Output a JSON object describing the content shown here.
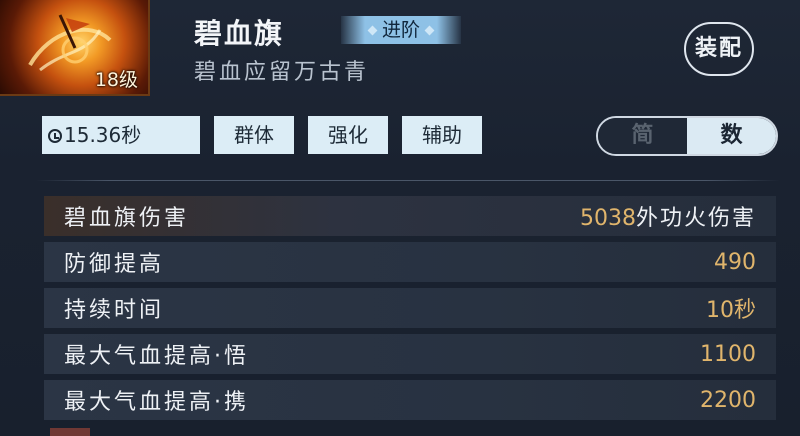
{
  "skill": {
    "level": "18级",
    "name": "碧血旗",
    "advance_tag": "进阶",
    "subtitle": "碧血应留万古青",
    "equip_label": "装配",
    "icon": "flame-swirl-icon"
  },
  "tags": {
    "cooldown": "15.36秒",
    "items": [
      "群体",
      "强化",
      "辅助"
    ]
  },
  "view_toggle": {
    "options": [
      "简",
      "数"
    ],
    "selected": "数"
  },
  "stats": [
    {
      "label": "碧血旗伤害",
      "value": "5038",
      "suffix": "外功火伤害"
    },
    {
      "label": "防御提高",
      "value": "490",
      "suffix": ""
    },
    {
      "label": "持续时间",
      "value": "10秒",
      "suffix": ""
    },
    {
      "label": "最大气血提高·悟",
      "value": "1100",
      "suffix": ""
    },
    {
      "label": "最大气血提高·携",
      "value": "2200",
      "suffix": ""
    }
  ],
  "colors": {
    "value_gold": "#e0b56c",
    "tag_bg": "#dcedf6",
    "advance_tag_bg": "#8ec1e6"
  }
}
